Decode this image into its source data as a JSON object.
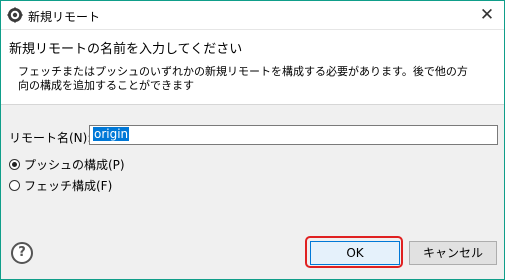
{
  "window": {
    "title": "新規リモート",
    "close_glyph": "✕"
  },
  "header": {
    "title": "新規リモートの名前を入力してください",
    "message": "フェッチまたはプッシュのいずれかの新規リモートを構成する必要があります。後で他の方向の構成を追加することができます"
  },
  "form": {
    "name_label": "リモート名(N):",
    "name_value": "origin",
    "options": [
      {
        "label": "プッシュの構成(P)",
        "checked": true
      },
      {
        "label": "フェッチ構成(F)",
        "checked": false
      }
    ]
  },
  "footer": {
    "help_glyph": "?",
    "ok_label": "OK",
    "cancel_label": "キャンセル"
  },
  "colors": {
    "accent": "#0078d7",
    "highlight": "#e02020",
    "border": "#0f9e8a"
  }
}
